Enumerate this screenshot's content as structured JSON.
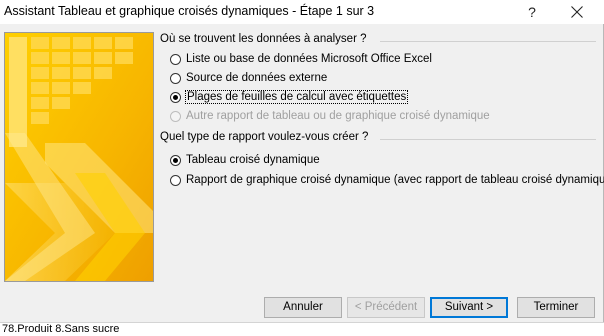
{
  "window": {
    "title": "Assistant Tableau et graphique croisés dynamiques - Étape 1 sur 3",
    "help_symbol": "?",
    "close_icon": "close-icon"
  },
  "banner": {
    "colors": {
      "main": "#f7b500",
      "light": "#ffd84d",
      "pale": "#ffe680"
    },
    "icon": "pivot-table-wizard-illustration"
  },
  "source_group": {
    "label": "Où se trouvent les données à analyser ?",
    "options": [
      {
        "label": "Liste ou base de données Microsoft Office Excel",
        "checked": false,
        "enabled": true
      },
      {
        "label": "Source de données externe",
        "checked": false,
        "enabled": true
      },
      {
        "label": "Plages de feuilles de calcul avec étiquettes",
        "checked": true,
        "enabled": true
      },
      {
        "label": "Autre rapport de tableau ou de graphique croisé dynamique",
        "checked": false,
        "enabled": false
      }
    ]
  },
  "report_group": {
    "label": "Quel type de rapport voulez-vous créer ?",
    "options": [
      {
        "label": "Tableau croisé dynamique",
        "checked": true,
        "enabled": true
      },
      {
        "label": "Rapport de graphique croisé dynamique (avec rapport de tableau croisé dynamique)",
        "checked": false,
        "enabled": true
      }
    ]
  },
  "buttons": {
    "cancel": "Annuler",
    "previous": "< Précédent",
    "next": "Suivant >",
    "finish": "Terminer"
  },
  "background": {
    "cell_text": "78.Produit 8.Sans sucre"
  },
  "colors": {
    "dialog_bg": "#f0f0f0",
    "button_bg": "#e1e1e1",
    "default_border": "#0078d7"
  }
}
